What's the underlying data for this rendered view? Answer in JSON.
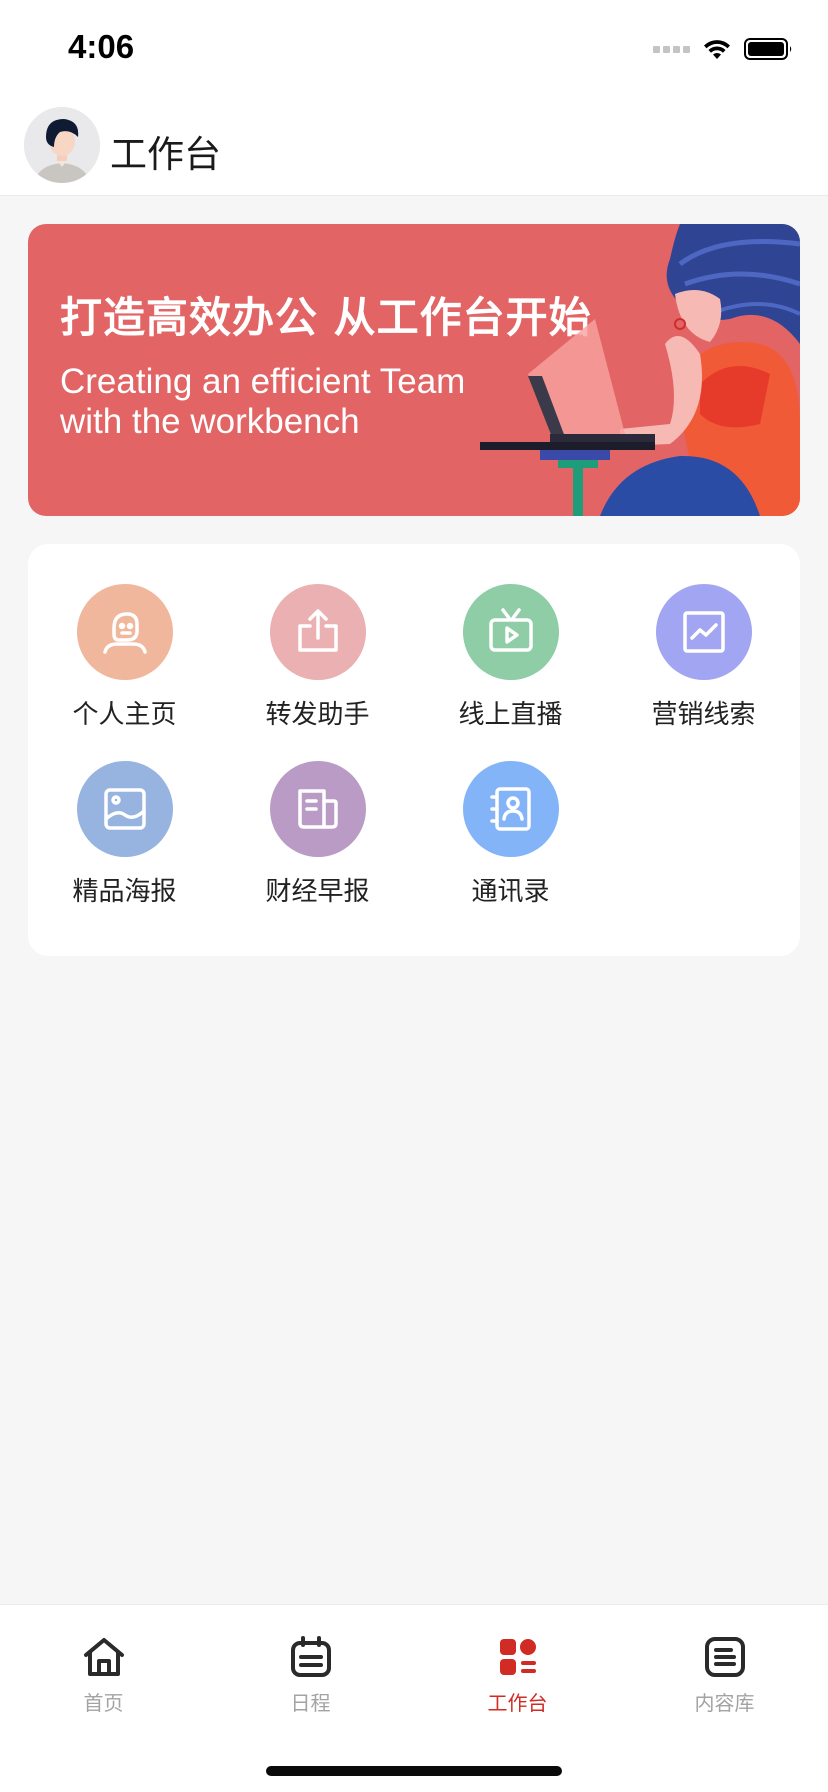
{
  "status_bar": {
    "time": "4:06"
  },
  "header": {
    "title": "工作台",
    "avatar_icon": "user-avatar"
  },
  "banner": {
    "title": "打造高效办公 从工作台开始",
    "subtitle_line1": "Creating an efficient Team",
    "subtitle_line2": "with the workbench",
    "background_color": "#e26465"
  },
  "tools": [
    {
      "label": "个人主页",
      "icon": "profile-icon",
      "color": "#f1b79c"
    },
    {
      "label": "转发助手",
      "icon": "share-icon",
      "color": "#ebb0b1"
    },
    {
      "label": "线上直播",
      "icon": "live-tv-icon",
      "color": "#8ecda6"
    },
    {
      "label": "营销线索",
      "icon": "chart-icon",
      "color": "#a2a6f2"
    },
    {
      "label": "精品海报",
      "icon": "poster-image-icon",
      "color": "#97b3df"
    },
    {
      "label": "财经早报",
      "icon": "newspaper-icon",
      "color": "#b99bc6"
    },
    {
      "label": "通讯录",
      "icon": "contacts-icon",
      "color": "#82b4f7"
    }
  ],
  "tabbar": {
    "items": [
      {
        "label": "首页",
        "icon": "home-icon",
        "active": false
      },
      {
        "label": "日程",
        "icon": "calendar-icon",
        "active": false
      },
      {
        "label": "工作台",
        "icon": "workbench-icon",
        "active": true
      },
      {
        "label": "内容库",
        "icon": "content-library-icon",
        "active": false
      }
    ],
    "active_color": "#d12b25",
    "inactive_color": "#a3a3a3"
  }
}
